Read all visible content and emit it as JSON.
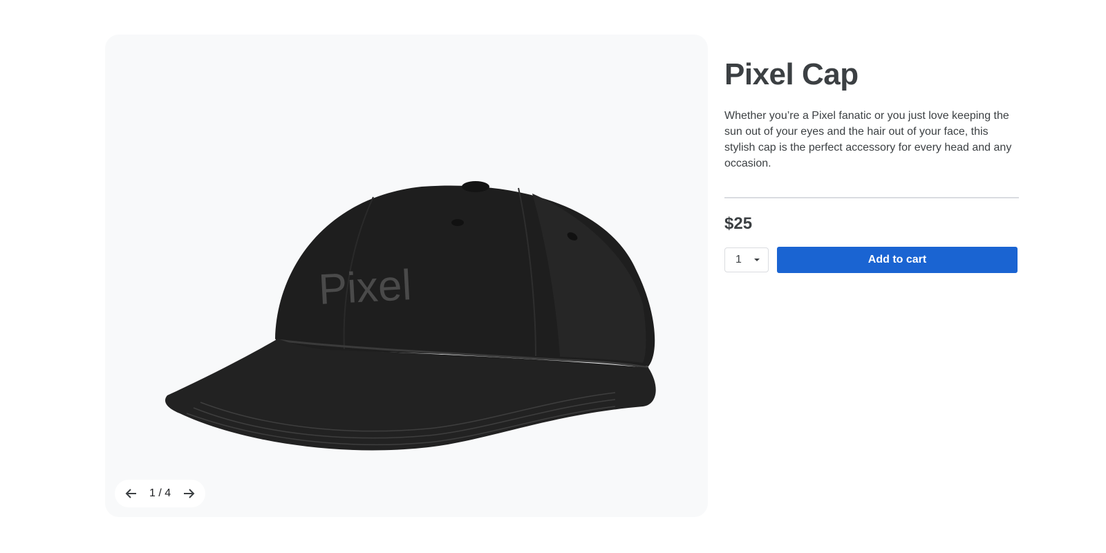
{
  "product": {
    "image_name": "black Pixel baseball cap",
    "embroidery_text": "Pixel",
    "title": "Pixel Cap",
    "description": "Whether you’re a Pixel fanatic or you just love keeping the sun out of your eyes and the hair out of your face, this stylish cap is the perfect accessory for every head and any occasion.",
    "price": "$25"
  },
  "gallery": {
    "counter": "1 / 4",
    "prev_icon": "arrow-left-icon",
    "next_icon": "arrow-right-icon"
  },
  "purchase": {
    "quantity": "1",
    "add_to_cart_label": "Add to cart"
  },
  "colors": {
    "accent": "#1a64d2",
    "gallery_bg": "#f8f9fa",
    "text": "#3c4043",
    "divider": "#dadce0"
  }
}
